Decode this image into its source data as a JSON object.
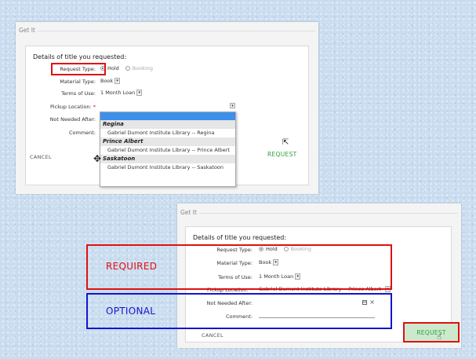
{
  "top": {
    "panel_title": "Get It",
    "heading": "Details of title you requested:",
    "request_type_label": "Request Type:",
    "hold": "Hold",
    "booking": "Booking",
    "material_type_label": "Material Type:",
    "material_type_value": "Book",
    "terms_label": "Terms of Use:",
    "terms_value": "1 Month Loan",
    "pickup_label": "Pickup Location:",
    "not_needed_label": "Not Needed After:",
    "comment_label": "Comment:",
    "cancel": "CANCEL",
    "request": "REQUEST",
    "dropdown": [
      {
        "type": "group",
        "label": "Regina"
      },
      {
        "type": "item",
        "label": "Gabriel Dumont Institute Library -- Regina"
      },
      {
        "type": "group",
        "label": "Prince Albert"
      },
      {
        "type": "item",
        "label": "Gabriel Dumont Institute Library -- Prince Albert"
      },
      {
        "type": "group",
        "label": "Saskatoon"
      },
      {
        "type": "item",
        "label": "Gabriel Dumont Institute Library -- Saskatoon"
      }
    ]
  },
  "bottom": {
    "panel_title": "Get It",
    "heading": "Details of title you requested:",
    "request_type_label": "Request Type:",
    "hold": "Hold",
    "booking": "Booking",
    "material_type_label": "Material Type:",
    "material_type_value": "Book",
    "terms_label": "Terms of Use:",
    "terms_value": "1 Month Loan",
    "pickup_label": "Pickup Location:",
    "pickup_value": "Gabriel Dumont Institute Library -- Prince Albert",
    "not_needed_label": "Not Needed After:",
    "comment_label": "Comment:",
    "cancel": "CANCEL",
    "request": "REQUEST"
  },
  "annotations": {
    "required": "REQUIRED",
    "optional": "OPTIONAL",
    "required_color": "#e01010",
    "optional_color": "#1414d0"
  },
  "colors": {
    "request_green": "#2e9e3f",
    "selection_blue": "#3d8fe9",
    "required_star": "#d0021b"
  }
}
